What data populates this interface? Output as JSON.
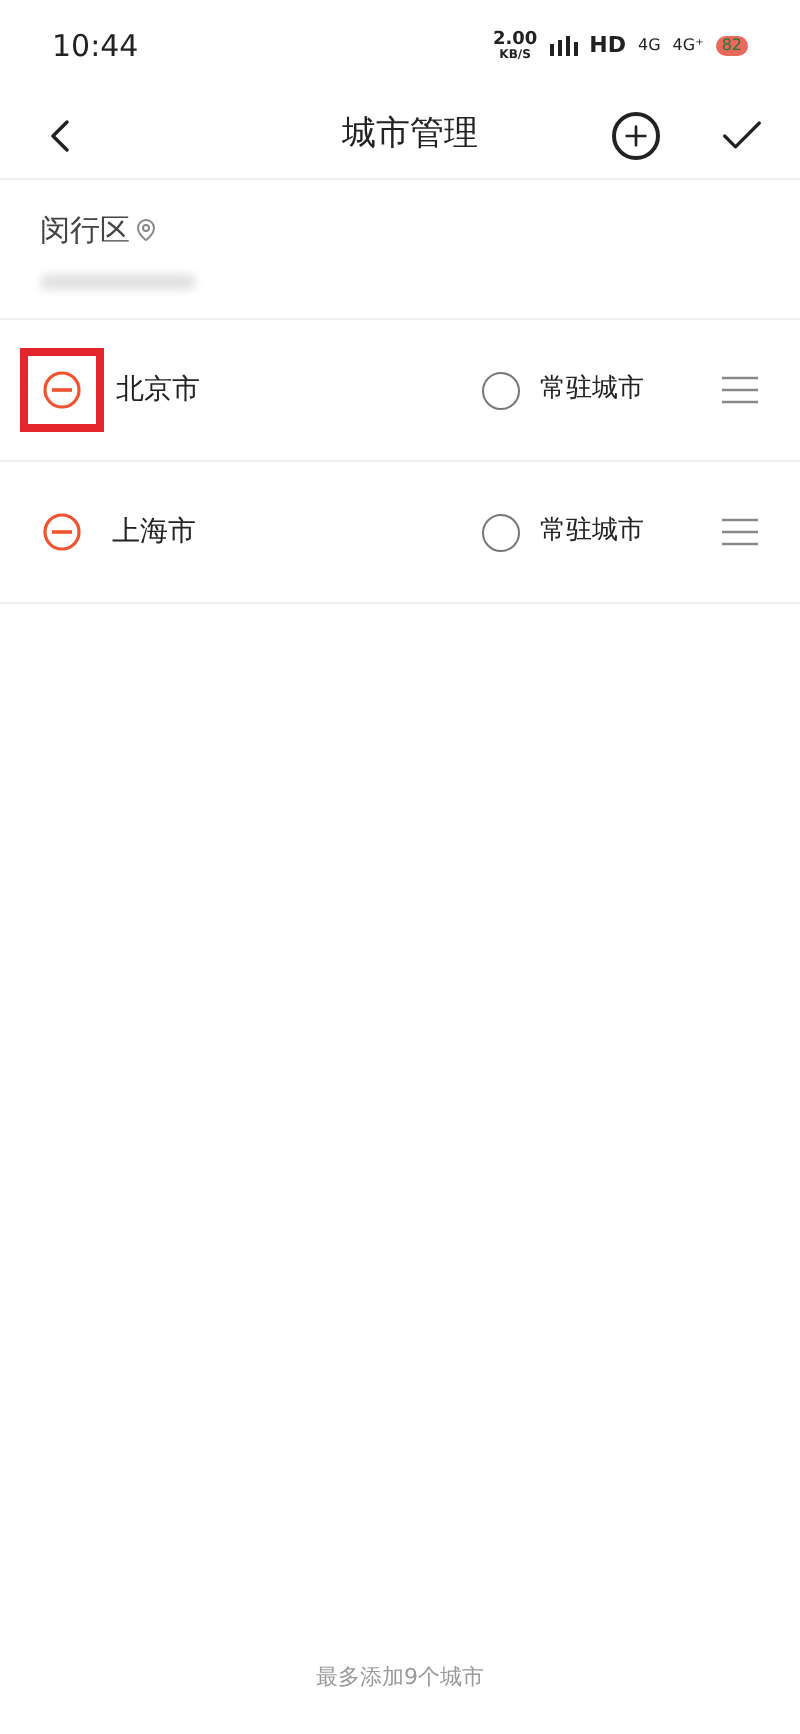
{
  "status_bar": {
    "time": "10:44",
    "speed": "2.00",
    "speed_unit": "KB/S",
    "hd": "HD",
    "network_1": "4G",
    "network_2": "4G⁺",
    "battery": "82"
  },
  "header": {
    "title": "城市管理"
  },
  "location": {
    "name": "闵行区"
  },
  "cities": [
    {
      "name": "北京市",
      "resident_label": "常驻城市",
      "resident": false,
      "highlighted": true
    },
    {
      "name": "上海市",
      "resident_label": "常驻城市",
      "resident": false,
      "highlighted": false
    }
  ],
  "footer": {
    "note": "最多添加9个城市"
  }
}
